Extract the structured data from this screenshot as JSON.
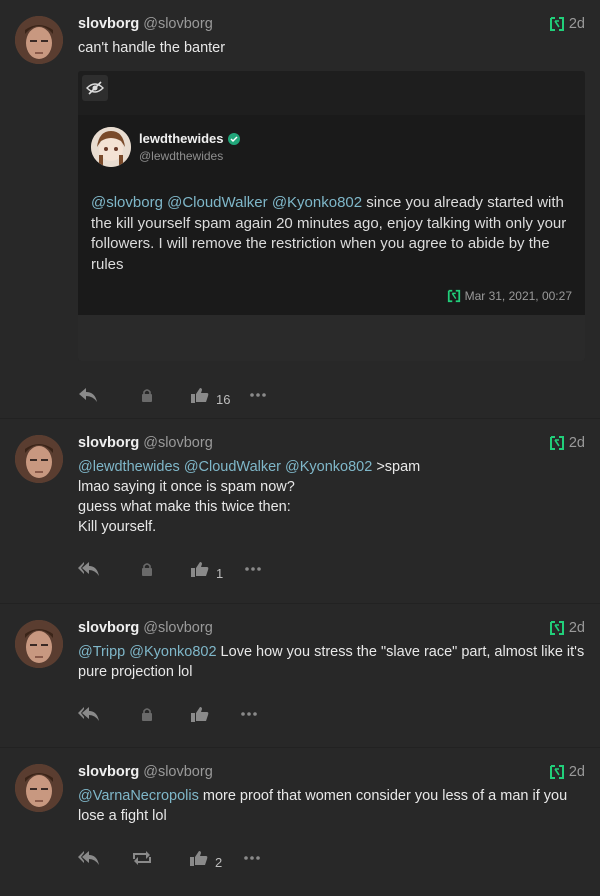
{
  "posts": [
    {
      "username": "slovborg",
      "handle": "@slovborg",
      "time": "2d",
      "text": "can't handle the banter",
      "quote": {
        "username": "lewdthewides",
        "handle": "@lewdthewides",
        "mentions": [
          "@slovborg",
          "@CloudWalker",
          "@Kyonko802"
        ],
        "text": " since you already started with the kill yourself spam again 20 minutes ago, enjoy talking with only your followers. I will remove the restriction when you agree to abide by the rules",
        "timestamp": "Mar 31, 2021, 00:27"
      },
      "likes": "16"
    },
    {
      "username": "slovborg",
      "handle": "@slovborg",
      "time": "2d",
      "mentions": [
        "@lewdthewides",
        "@CloudWalker",
        "@Kyonko802"
      ],
      "lines": [
        " >spam",
        "lmao saying it once is spam now?",
        "guess what make this twice then:",
        "Kill yourself."
      ],
      "likes": "1"
    },
    {
      "username": "slovborg",
      "handle": "@slovborg",
      "time": "2d",
      "mentions": [
        "@Tripp",
        "@Kyonko802"
      ],
      "text": " Love how you stress the \"slave race\" part, almost like it's pure projection lol",
      "likes": ""
    },
    {
      "username": "slovborg",
      "handle": "@slovborg",
      "time": "2d",
      "mentions": [
        "@VarnaNecropolis"
      ],
      "text": " more proof that women consider you less of a man if you lose a fight lol",
      "likes": "2"
    }
  ],
  "icons": {
    "reply": "reply-icon",
    "reply_all": "reply-all-icon",
    "lock": "lock-icon",
    "repost": "repost-icon",
    "like": "thumbs-up-icon",
    "more": "ellipsis-icon",
    "quote_brand": "gab-logo-icon",
    "hide": "eye-slash-icon",
    "verified": "verified-badge-icon"
  },
  "colors": {
    "background": "#282828",
    "mention": "#7fb7c9",
    "brand": "#21cf7a"
  }
}
